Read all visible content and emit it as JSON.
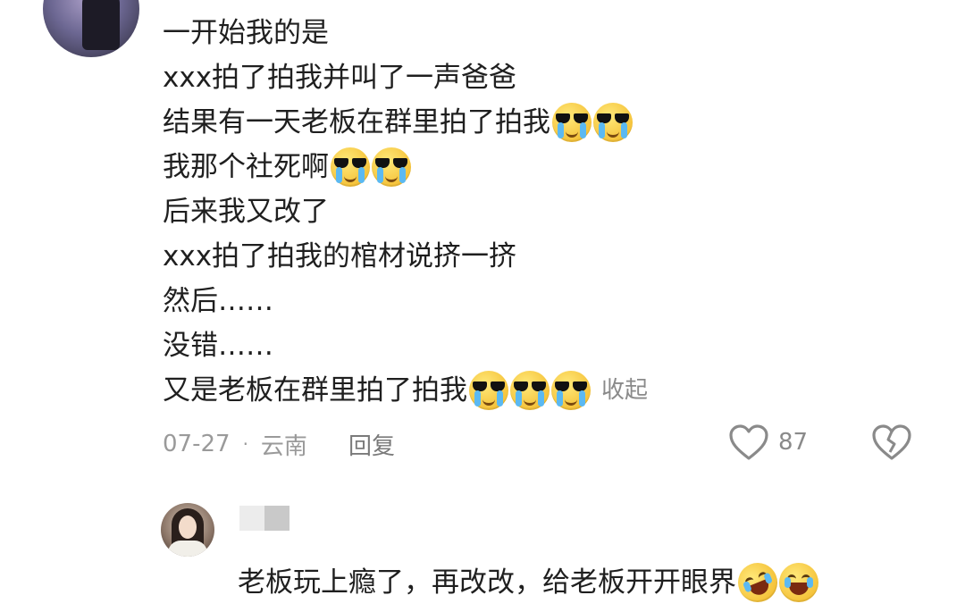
{
  "comment": {
    "lines": [
      "一开始我的是",
      "xxx拍了拍我并叫了一声爸爸",
      "结果有一天老板在群里拍了拍我",
      "我那个社死啊",
      "后来我又改了",
      "xxx拍了拍我的棺材说挤一挤",
      "然后……",
      "没错……",
      "又是老板在群里拍了拍我"
    ],
    "collapse_label": "收起",
    "date": "07-27",
    "separator": "·",
    "location": "云南",
    "reply_label": "回复",
    "like_count": "87",
    "emoji_icon": "cool-crying-emoji"
  },
  "reply": {
    "text": "老板玩上瘾了，再改改，给老板开开眼界",
    "emoji_icons": [
      "rolling-laugh-emoji",
      "crying-laugh-emoji"
    ]
  },
  "colors": {
    "text": "#1f1f1f",
    "meta": "#9a9a9a",
    "emoji_yellow": "#f5c33b"
  }
}
